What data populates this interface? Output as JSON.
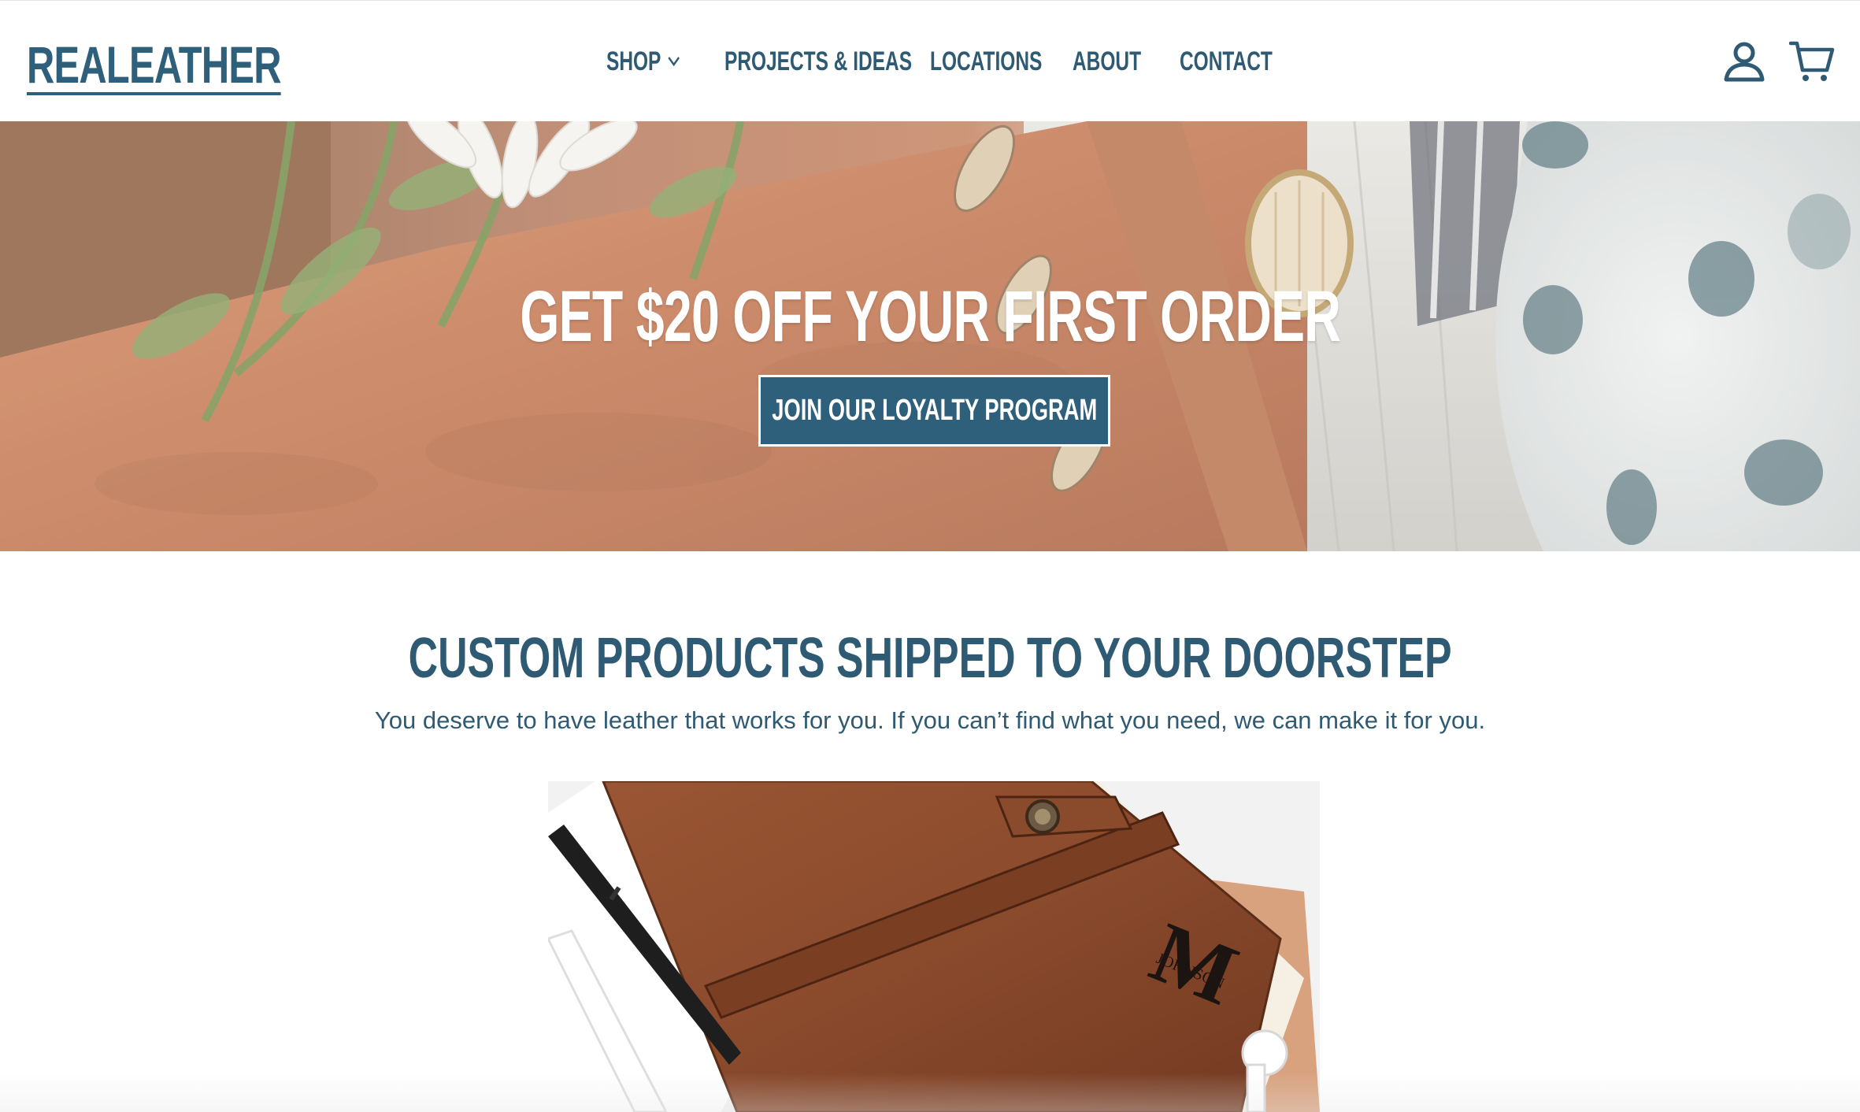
{
  "brand": {
    "logo_text": "REALEATHER",
    "color": "#2e5f7b"
  },
  "nav": {
    "items": [
      {
        "label": "SHOP",
        "has_dropdown": true
      },
      {
        "label": "PROJECTS & IDEAS"
      },
      {
        "label": "LOCATIONS"
      },
      {
        "label": "ABOUT"
      },
      {
        "label": "CONTACT"
      }
    ]
  },
  "header_icons": [
    "account-icon",
    "cart-icon"
  ],
  "hero": {
    "title": "GET $20 OFF YOUR FIRST ORDER",
    "button_label": "JOIN OUR LOYALTY PROGRAM"
  },
  "section": {
    "title": "CUSTOM PRODUCTS SHIPPED TO YOUR DOORSTEP",
    "subtitle": "You deserve to have leather that works for you. If you can’t find what you need, we can make it for you."
  },
  "product_image": {
    "monogram_initial": "M",
    "monogram_name": "JOHNSON"
  },
  "colors": {
    "accent": "#2e5f7b",
    "text": "#2e5a73",
    "background": "#ffffff"
  }
}
